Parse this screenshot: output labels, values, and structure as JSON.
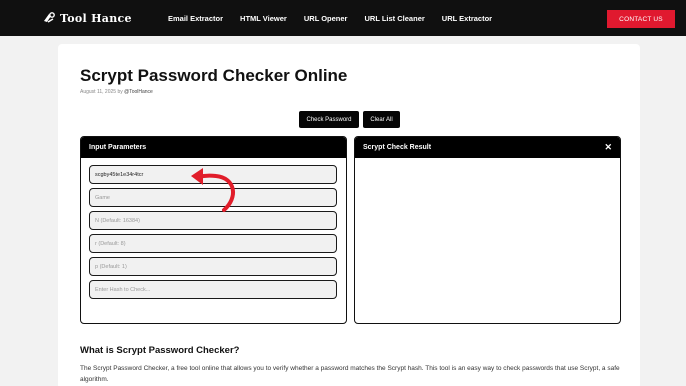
{
  "header": {
    "logo_text": "Tool Hance",
    "nav": [
      "Email Extractor",
      "HTML Viewer",
      "URL Opener",
      "URL List Cleaner",
      "URL Extractor"
    ],
    "contact_label": "CONTACT US"
  },
  "page": {
    "title": "Scrypt Password Checker Online",
    "date": "August 11, 2025",
    "by": "by",
    "author": "@ToolHance"
  },
  "actions": {
    "check_label": "Check Password",
    "clear_label": "Clear All"
  },
  "input_panel": {
    "title": "Input Parameters",
    "password_value": "scgby45te1e34r4tcr",
    "salt_placeholder": "Game",
    "n_placeholder": "N (Default: 16384)",
    "r_placeholder": "r (Default: 8)",
    "p_placeholder": "p (Default: 1)",
    "hash_placeholder": "Enter Hash to Check..."
  },
  "result_panel": {
    "title": "Scrypt Check Result",
    "close_glyph": "✕"
  },
  "article": {
    "heading": "What is Scrypt Password Checker?",
    "paragraph": "The Scrypt Password Checker, a free tool online that allows you to verify whether a password matches the Scrypt hash. This tool is an easy way to check passwords that use Scrypt, a safe algorithm."
  },
  "colors": {
    "topbar": "#101010",
    "accent_red": "#e0192f",
    "arrow_red": "#e11d2a"
  }
}
